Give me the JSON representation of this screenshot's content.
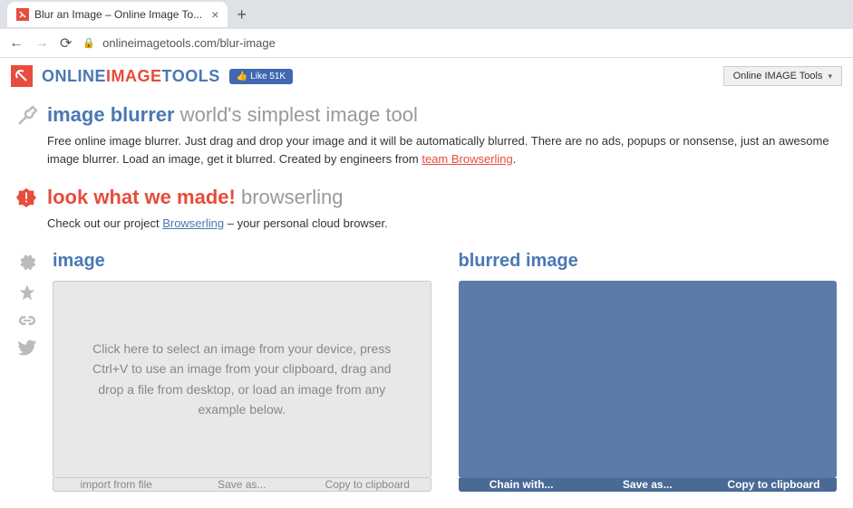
{
  "browser": {
    "tab_title": "Blur an Image – Online Image To...",
    "url": "onlineimagetools.com/blur-image"
  },
  "header": {
    "brand_online": "ONLINE",
    "brand_image": "IMAGE",
    "brand_tools": "TOOLS",
    "fb_like": "Like 51K",
    "menu_button": "Online IMAGE Tools"
  },
  "intro": {
    "title_main": "image blurrer",
    "title_sub": "world's simplest image tool",
    "text_before": "Free online image blurrer. Just drag and drop your image and it will be automatically blurred. There are no ads, popups or nonsense, just an awesome image blurrer. Load an image, get it blurred. Created by engineers from ",
    "link": "team Browserling",
    "text_after": "."
  },
  "promo": {
    "title_main": "look what we made!",
    "title_sub": "browserling",
    "text_before": "Check out our project ",
    "link": "Browserling",
    "text_after": " – your personal cloud browser."
  },
  "panels": {
    "input_title": "image",
    "output_title": "blurred image",
    "dropzone_text": "Click here to select an image from your device, press Ctrl+V to use an image from your clipboard, drag and drop a file from desktop, or load an image from any example below.",
    "input_actions": [
      "import from file",
      "Save as...",
      "Copy to clipboard"
    ],
    "output_actions": [
      "Chain with...",
      "Save as...",
      "Copy to clipboard"
    ]
  }
}
